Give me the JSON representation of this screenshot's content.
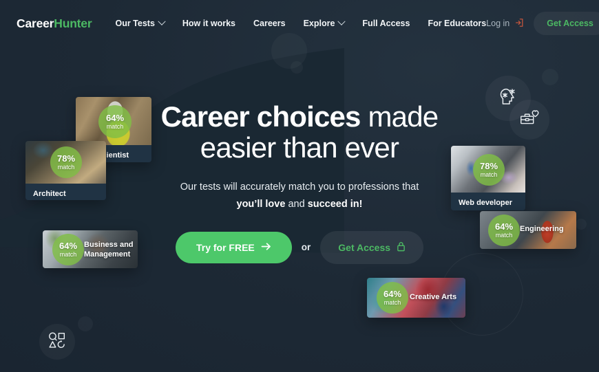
{
  "brand": {
    "name_part1": "Career",
    "name_part2": "Hunter",
    "accent_green": "#4cb963",
    "cta_green": "#4dc86a",
    "background": "#1c2835"
  },
  "nav": {
    "links": [
      {
        "label": "Our Tests",
        "has_chevron": true
      },
      {
        "label": "How it works",
        "has_chevron": false
      },
      {
        "label": "Careers",
        "has_chevron": false
      },
      {
        "label": "Explore",
        "has_chevron": true
      },
      {
        "label": "Full Access",
        "has_chevron": false
      },
      {
        "label": "For Educators",
        "has_chevron": false
      }
    ],
    "login_label": "Log in",
    "login_icon": "login-arrow-icon",
    "get_access_label": "Get Access",
    "menu_icon": "hamburger-menu-icon"
  },
  "hero": {
    "headline_strong": "Career choices",
    "headline_light": " made",
    "headline_line2": "easier than ever",
    "sub_line1": "Our tests will accurately match you to professions that",
    "sub_bold1": "you’ll love",
    "sub_mid": " and ",
    "sub_bold2": "succeed in!",
    "cta_primary": "Try for FREE",
    "cta_primary_icon": "arrow-right-icon",
    "cta_or": "or",
    "cta_secondary": "Get Access",
    "cta_secondary_icon": "lock-icon"
  },
  "cards": [
    {
      "id": "geoscientist",
      "title": "Geoscientist",
      "match": "64%",
      "match_word": "match",
      "label_position": "below"
    },
    {
      "id": "architect",
      "title": "Architect",
      "match": "78%",
      "match_word": "match",
      "label_position": "below"
    },
    {
      "id": "business-and-management",
      "title": "Business and Management",
      "title_line1": "Business and",
      "title_line2": "Management",
      "match": "64%",
      "match_word": "match",
      "label_position": "overlay"
    },
    {
      "id": "web-developer",
      "title": "Web developer",
      "match": "78%",
      "match_word": "match",
      "label_position": "below"
    },
    {
      "id": "engineering",
      "title": "Engineering",
      "match": "64%",
      "match_word": "match",
      "label_position": "overlay"
    },
    {
      "id": "creative-arts",
      "title": "Creative Arts",
      "match": "64%",
      "match_word": "match",
      "label_position": "overlay"
    }
  ],
  "decor_icons": [
    {
      "id": "personality-head-icon",
      "name": "head-sparkle-icon"
    },
    {
      "id": "interests-briefcase-icon",
      "name": "briefcase-heart-icon"
    },
    {
      "id": "aptitude-shapes-icon",
      "name": "shapes-icon"
    }
  ]
}
